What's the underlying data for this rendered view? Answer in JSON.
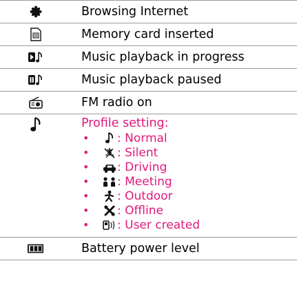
{
  "rows": [
    {
      "icon": "globe-icon",
      "label": "Browsing Internet"
    },
    {
      "icon": "memory-card-icon",
      "label": "Memory card inserted"
    },
    {
      "icon": "music-playing-icon",
      "label": "Music playback in progress"
    },
    {
      "icon": "music-paused-icon",
      "label": "Music playback paused"
    },
    {
      "icon": "fm-radio-icon",
      "label": "FM radio on"
    },
    {
      "icon": "music-note-icon",
      "label": "Profile setting:"
    },
    {
      "icon": "battery-icon",
      "label": "Battery power level"
    }
  ],
  "profiles": [
    {
      "icon": "normal-note-icon",
      "label": ": Normal"
    },
    {
      "icon": "silent-icon",
      "label": ": Silent"
    },
    {
      "icon": "car-icon",
      "label": ": Driving"
    },
    {
      "icon": "meeting-icon",
      "label": ": Meeting"
    },
    {
      "icon": "outdoor-icon",
      "label": ": Outdoor"
    },
    {
      "icon": "offline-icon",
      "label": ": Offline"
    },
    {
      "icon": "user-created-icon",
      "label": ": User created"
    }
  ],
  "bullet": "•",
  "colors": {
    "profile_text": "#e0197d",
    "rule": "#9a9a9a"
  }
}
